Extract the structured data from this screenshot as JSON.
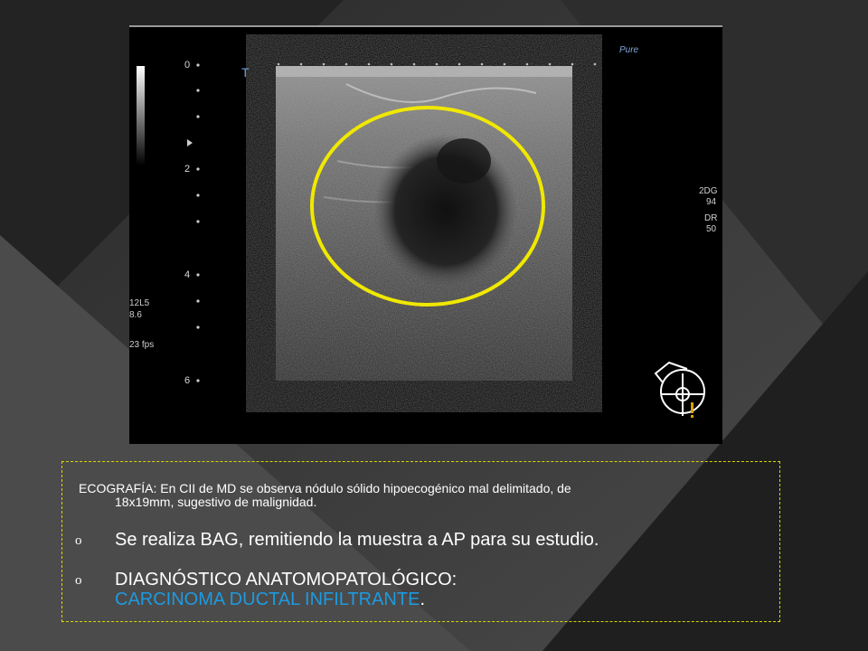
{
  "ultrasound": {
    "probe": "12L5",
    "frequency": "8.6",
    "fps": "23 fps",
    "gain": "2DG",
    "gain_value": "94",
    "dr": "DR",
    "dr_value": "50",
    "depth_marks": [
      "0",
      "2",
      "4",
      "6"
    ],
    "logo": "Pure",
    "colors": {
      "circle": "#f0e800",
      "marker": "#e0a000"
    }
  },
  "report": {
    "finding": "ECOGRAFÍA: En CII de MD se observa nódulo sólido hipoecogénico mal delimitado, de",
    "finding_cont": "18x19mm, sugestivo de malignidad.",
    "bullet_symbol": "o",
    "bullet1": "Se realiza BAG, remitiendo la muestra a AP para su estudio.",
    "bullet2_label": "DIAGNÓSTICO ANATOMOPATOLÓGICO:",
    "bullet2_diagnosis": "CARCINOMA DUCTAL INFILTRANTE",
    "bullet2_end": ".",
    "colors": {
      "diagnosis": "#1e9ae0",
      "border": "#d8d800"
    }
  }
}
